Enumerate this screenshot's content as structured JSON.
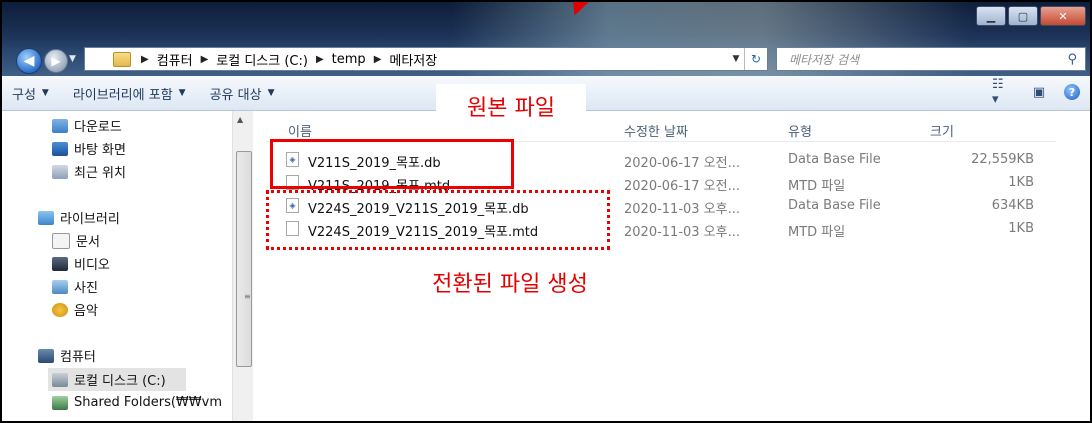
{
  "address_bar": {
    "crumbs": [
      "컴퓨터",
      "로컬 디스크 (C:)",
      "temp",
      "메타저장"
    ]
  },
  "search": {
    "placeholder": "메타저장 검색"
  },
  "toolbar": {
    "organize": "구성",
    "include_in_library": "라이브러리에 포함",
    "share_with": "공유 대상"
  },
  "nav": {
    "items": [
      {
        "label": "다운로드",
        "icon": "download-folder-icon"
      },
      {
        "label": "바탕 화면",
        "icon": "desktop-icon"
      },
      {
        "label": "최근 위치",
        "icon": "recent-places-icon"
      },
      {
        "label": "라이브러리",
        "icon": "library-icon"
      },
      {
        "label": "문서",
        "icon": "documents-icon"
      },
      {
        "label": "비디오",
        "icon": "video-icon"
      },
      {
        "label": "사진",
        "icon": "pictures-icon"
      },
      {
        "label": "음악",
        "icon": "music-icon"
      },
      {
        "label": "컴퓨터",
        "icon": "computer-icon"
      },
      {
        "label": "로컬 디스크 (C:)",
        "icon": "local-disk-icon"
      },
      {
        "label": "Shared Folders(₩₩vm",
        "icon": "network-drive-icon"
      }
    ]
  },
  "columns": {
    "name": "이름",
    "modified": "수정한 날짜",
    "type": "유형",
    "size": "크기"
  },
  "files": [
    {
      "name": "V211S_2019_목포.db",
      "modified": "2020-06-17 오전...",
      "type": "Data Base File",
      "size": "22,559KB"
    },
    {
      "name": "V211S_2019_목포.mtd",
      "modified": "2020-06-17 오전...",
      "type": "MTD 파일",
      "size": "1KB"
    },
    {
      "name": "V224S_2019_V211S_2019_목포.db",
      "modified": "2020-11-03 오후...",
      "type": "Data Base File",
      "size": "634KB"
    },
    {
      "name": "V224S_2019_V211S_2019_목포.mtd",
      "modified": "2020-11-03 오후...",
      "type": "MTD 파일",
      "size": "1KB"
    }
  ],
  "annotations": {
    "original_file": "원본 파일",
    "converted_file": "전환된 파일 생성"
  },
  "colors": {
    "annotation": "#e60000",
    "toolbar_text": "#1e395b"
  }
}
